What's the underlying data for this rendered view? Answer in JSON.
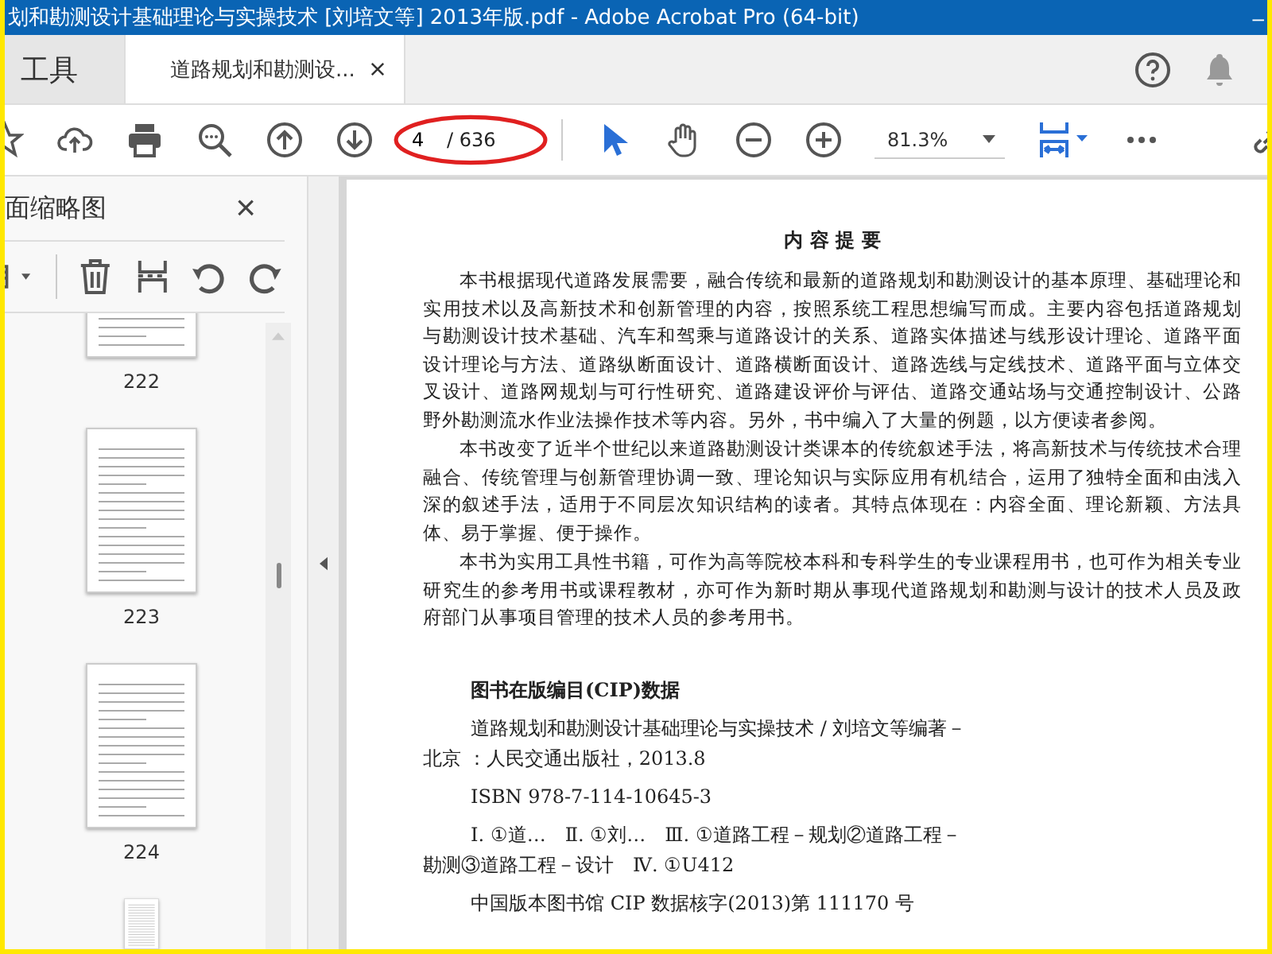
{
  "window": {
    "title": "划和勘测设计基础理论与实操技术 [刘培文等] 2013年版.pdf - Adobe Acrobat Pro (64-bit)",
    "minimize": "–"
  },
  "tabs": [
    {
      "label": "工具",
      "selected": false,
      "closable": false
    },
    {
      "label": "道路规划和勘测设...",
      "selected": true,
      "closable": true
    }
  ],
  "toolbar": {
    "page_field": "4",
    "page_total": "/ 636",
    "zoom": "81.3%"
  },
  "sidebar": {
    "title": "面缩略图",
    "close": "×",
    "thumbnails": [
      {
        "label": "222"
      },
      {
        "label": "223"
      },
      {
        "label": "224"
      }
    ]
  },
  "document": {
    "heading": "内 容 提 要",
    "paragraphs": [
      "本书根据现代道路发展需要，融合传统和最新的道路规划和勘测设计的基本原理、基础理论和实用技术以及高新技术和创新管理的内容，按照系统工程思想编写而成。主要内容包括道路规划与勘测设计技术基础、汽车和驾乘与道路设计的关系、道路实体描述与线形设计理论、道路平面设计理论与方法、道路纵断面设计、道路横断面设计、道路选线与定线技术、道路平面与立体交叉设计、道路网规划与可行性研究、道路建设评价与评估、道路交通站场与交通控制设计、公路野外勘测流水作业法操作技术等内容。另外，书中编入了大量的例题，以方便读者参阅。",
      "本书改变了近半个世纪以来道路勘测设计类课本的传统叙述手法，将高新技术与传统技术合理融合、传统管理与创新管理协调一致、理论知识与实际应用有机结合，运用了独特全面和由浅入深的叙述手法，适用于不同层次知识结构的读者。其特点体现在：内容全面、理论新颖、方法具体、易于掌握、便于操作。",
      "本书为实用工具性书籍，可作为高等院校本科和专科学生的专业课程用书，也可作为相关专业研究生的参考用书或课程教材，亦可作为新时期从事现代道路规划和勘测与设计的技术人员及政府部门从事项目管理的技术人员的参考用书。"
    ],
    "cip_title": "图书在版编目(CIP)数据",
    "cip_entries": [
      "道路规划和勘测设计基础理论与实操技术 / 刘培文等编著－北京 ：人民交通出版社，2013.8",
      "ISBN 978-7-114-10645-3",
      "Ⅰ. ①道…　Ⅱ. ①刘…　Ⅲ. ①道路工程－规划②道路工程－勘测③道路工程－设计　Ⅳ. ①U412",
      "中国版本图书馆 CIP 数据核字(2013)第 111170 号"
    ]
  }
}
